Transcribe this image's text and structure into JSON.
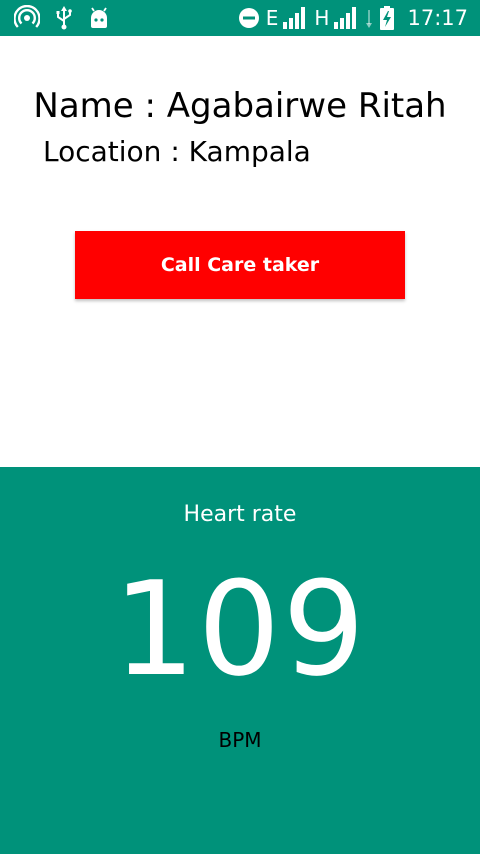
{
  "status_bar": {
    "left_icons": [
      "wifi-hotspot-icon",
      "usb-icon",
      "android-debug-icon"
    ],
    "right_icons": [
      "do-not-disturb-icon",
      "signal-e-icon",
      "signal-h-icon",
      "data-transfer-icon",
      "battery-charging-icon"
    ],
    "network_letter_1": "E",
    "network_letter_2": "H",
    "time": "17:17",
    "background_color": "#00927a"
  },
  "patient": {
    "name_line": "Name : Agabairwe Ritah",
    "location_line": "Location : Kampala"
  },
  "actions": {
    "call_button_label": "Call Care taker",
    "call_button_color": "#ff0000"
  },
  "heart_rate": {
    "title": "Heart rate",
    "value": "109",
    "unit": "BPM",
    "panel_color": "#00927a"
  }
}
